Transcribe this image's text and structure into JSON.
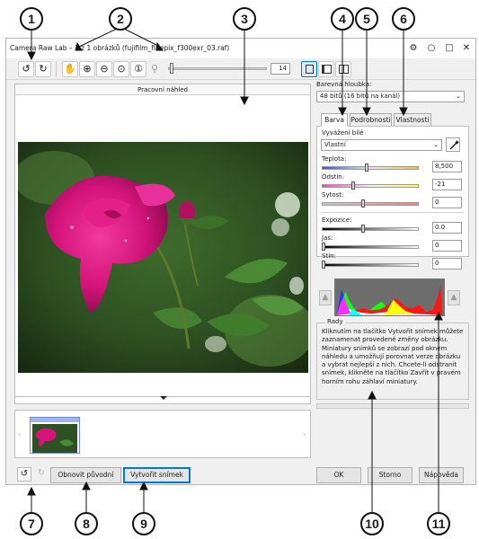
{
  "window": {
    "title": "Camera Raw Lab – 1 z 1 obrázků (fujifilm_finepix_f300exr_03.raf)",
    "controls": [
      "⚙",
      "○",
      "□",
      "✕"
    ]
  },
  "toolbar": {
    "zoom_value": "14",
    "buttons": [
      {
        "name": "rotate-left-button",
        "icon": "↺"
      },
      {
        "name": "rotate-right-button",
        "icon": "↻"
      },
      {
        "name": "pan-tool-button",
        "icon": "✋"
      },
      {
        "name": "zoom-in-button",
        "icon": "⊕"
      },
      {
        "name": "zoom-out-button",
        "icon": "⊖"
      },
      {
        "name": "zoom-fit-button",
        "icon": "⊙"
      },
      {
        "name": "zoom-100-button",
        "icon": "①"
      },
      {
        "name": "zoom-tool-icon",
        "icon": "⚲"
      }
    ]
  },
  "preview": {
    "header": "Pracovní náhled"
  },
  "right_panel": {
    "color_depth_label": "Barevná hloubka:",
    "color_depth_value": "48 bitů (16 bitů na kanál)",
    "tabs": [
      "Barva",
      "Podrobnosti",
      "Vlastnosti"
    ],
    "white_balance_label": "Vyvážení bílé",
    "white_balance_value": "Vlastní",
    "sliders": [
      {
        "label": "Teplota:",
        "value": "8,500",
        "level": 0.46,
        "kind": "temp"
      },
      {
        "label": "Odstín:",
        "value": "-21",
        "level": 0.32,
        "kind": "tint"
      },
      {
        "label": "Sytost:",
        "value": "0",
        "level": 0.42,
        "kind": "sat"
      },
      {
        "label": "Expozice:",
        "value": "0.0",
        "level": 0.42,
        "kind": "gray"
      },
      {
        "label": "Jas:",
        "value": "0",
        "level": 0.0,
        "kind": "gray"
      },
      {
        "label": "Stín:",
        "value": "0",
        "level": 0.0,
        "kind": "gray"
      }
    ],
    "hints_title": "Rady",
    "hints_text": "Kliknutím na tlačítko Vytvořit snímek můžete zaznamenat provedené změny obrázku. Miniatury snímků se zobrazí pod oknem náhledu a umožňují porovnat verze obrázku a vybrat nejlepší z nich. Chcete-li odstranit snímek, klikněte na tlačítko Zavřít v pravém horním rohu záhlaví miniatury."
  },
  "bottom": {
    "reset_label": "Obnovit původní",
    "snapshot_label": "Vytvořit snímek",
    "ok_label": "OK",
    "cancel_label": "Storno",
    "help_label": "Nápověda"
  },
  "callouts": [
    "1",
    "2",
    "3",
    "4",
    "5",
    "6",
    "7",
    "8",
    "9",
    "10",
    "11"
  ],
  "colors": {
    "accent": "#0078d7",
    "window_bg": "#f0f0f0",
    "flower": "#d4147a"
  }
}
